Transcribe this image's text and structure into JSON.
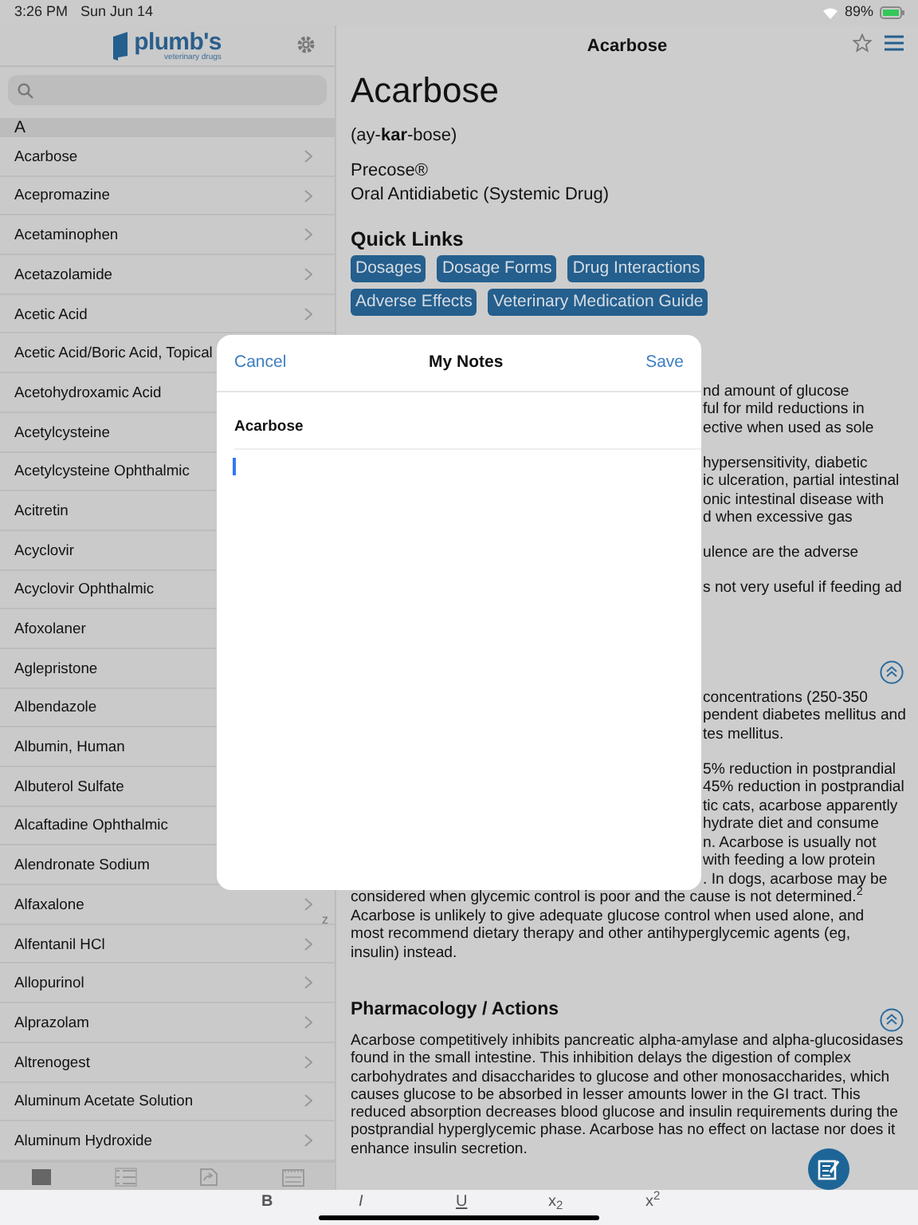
{
  "status_bar": {
    "time": "3:26 PM",
    "date": "Sun Jun 14",
    "battery": "89%"
  },
  "sidebar": {
    "logo": {
      "name": "plumb's",
      "tagline": "veterinary drugs"
    },
    "section": "A",
    "items": [
      {
        "label": "Acarbose",
        "chevron": true
      },
      {
        "label": "Acepromazine",
        "chevron": true
      },
      {
        "label": "Acetaminophen",
        "chevron": true
      },
      {
        "label": "Acetazolamide",
        "chevron": true
      },
      {
        "label": "Acetic Acid",
        "chevron": true
      },
      {
        "label": "Acetic Acid/Boric Acid, Topical",
        "chevron": false
      },
      {
        "label": "Acetohydroxamic Acid",
        "chevron": false
      },
      {
        "label": "Acetylcysteine",
        "chevron": false
      },
      {
        "label": "Acetylcysteine Ophthalmic",
        "chevron": false
      },
      {
        "label": "Acitretin",
        "chevron": false
      },
      {
        "label": "Acyclovir",
        "chevron": false
      },
      {
        "label": "Acyclovir Ophthalmic",
        "chevron": false
      },
      {
        "label": "Afoxolaner",
        "chevron": false
      },
      {
        "label": "Aglepristone",
        "chevron": false
      },
      {
        "label": "Albendazole",
        "chevron": false
      },
      {
        "label": "Albumin, Human",
        "chevron": false
      },
      {
        "label": "Albuterol Sulfate",
        "chevron": false
      },
      {
        "label": "Alcaftadine Ophthalmic",
        "chevron": false
      },
      {
        "label": "Alendronate Sodium",
        "chevron": false
      },
      {
        "label": "Alfaxalone",
        "chevron": true
      },
      {
        "label": "Alfentanil HCl",
        "chevron": true
      },
      {
        "label": "Allopurinol",
        "chevron": true
      },
      {
        "label": "Alprazolam",
        "chevron": true
      },
      {
        "label": "Altrenogest",
        "chevron": true
      },
      {
        "label": "Aluminum Acetate Solution",
        "chevron": true
      },
      {
        "label": "Aluminum Hydroxide",
        "chevron": true
      }
    ],
    "index_letter": "z",
    "tab_bar": [
      {
        "selected": true
      },
      {
        "selected": false
      },
      {
        "selected": false
      },
      {
        "selected": false
      }
    ]
  },
  "header": {
    "title": "Acarbose"
  },
  "drug": {
    "name": "Acarbose",
    "pronunciation": "(ay-**kar**-bose)",
    "brand": "Precose®",
    "drug_class": "Oral Antidiabetic (Systemic Drug)"
  },
  "quick_links": {
    "heading": "Quick Links",
    "links": [
      "Dosages",
      "Dosage Forms",
      "Drug Interactions",
      "Adverse Effects",
      "Veterinary Medication Guide"
    ]
  },
  "partial_section": {
    "paragraphs": [
      {
        "fragments": [
          "nd amount of glucose",
          "ful for mild reductions in",
          "ective when used as sole"
        ]
      },
      {
        "fragments": [
          "hypersensitivity, diabetic",
          "ic ulceration, partial intestinal",
          "onic intestinal disease with",
          "d when excessive gas"
        ]
      },
      {
        "fragments": [
          "ulence are the adverse"
        ]
      },
      {
        "fragments": [
          "s not very useful if feeding ad"
        ]
      }
    ]
  },
  "partial_section_2": {
    "paragraphs": [
      {
        "fragments": [
          "concentrations (250-350",
          "pendent diabetes mellitus and",
          "tes mellitus."
        ]
      },
      {
        "fragments": [
          "5% reduction in postprandial",
          "45% reduction in postprandial",
          "tic cats, acarbose apparently",
          "hydrate diet and consume",
          "n. Acarbose is usually not",
          "with feeding a low protein",
          ". In dogs, acarbose may be"
        ],
        "lines": [
          "considered when glycemic control is poor and the cause is not determined.$^{2}$",
          "Acarbose is unlikely to give adequate glucose control when used alone, and",
          "most recommend dietary therapy and other antihyperglycemic agents (eg,",
          "insulin) instead."
        ]
      }
    ]
  },
  "pharmacology": {
    "heading": "Pharmacology / Actions",
    "text": "Acarbose competitively inhibits pancreatic alpha-amylase and alpha-glucosidases found in the small intestine. This inhibition delays the digestion of complex carbohydrates and disaccharides to glucose and other monosaccharides, which causes glucose to be absorbed in lesser amounts lower in the GI tract. This reduced absorption decreases blood glucose and insulin requirements during the postprandial hyperglycemic phase. Acarbose has no effect on lactase nor does it enhance insulin secretion."
  },
  "modal": {
    "cancel": "Cancel",
    "title": "My Notes",
    "save": "Save",
    "note_title": "Acarbose"
  },
  "format_bar": [
    {
      "kind": "bold",
      "label": "B"
    },
    {
      "kind": "italic",
      "label": "I"
    },
    {
      "kind": "underline",
      "label": "U"
    },
    {
      "kind": "subscript",
      "label": "x$_{2}$"
    },
    {
      "kind": "superscript",
      "label": "x$^{2}$"
    }
  ]
}
